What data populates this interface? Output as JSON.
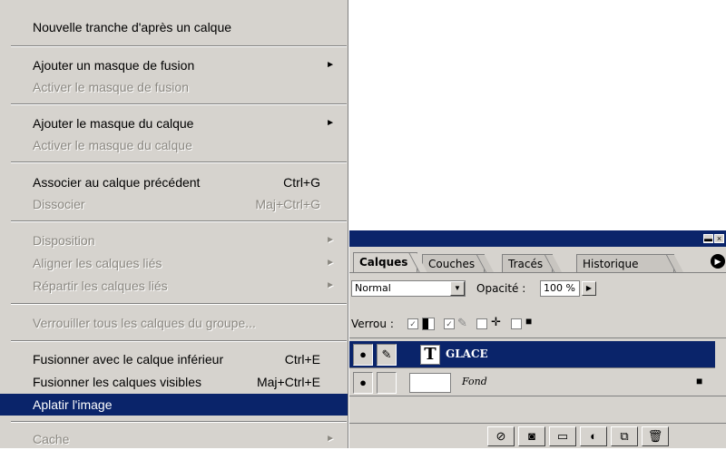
{
  "menu": {
    "items": [
      {
        "label": "Nouvelle tranche d'après un calque",
        "shortcut": "",
        "submenu": false,
        "disabled": false
      },
      {
        "label": "Ajouter un masque de fusion",
        "shortcut": "",
        "submenu": true,
        "disabled": false
      },
      {
        "label": "Activer le masque de fusion",
        "shortcut": "",
        "submenu": false,
        "disabled": true
      },
      {
        "label": "Ajouter le masque du calque",
        "shortcut": "",
        "submenu": true,
        "disabled": false
      },
      {
        "label": "Activer le masque du calque",
        "shortcut": "",
        "submenu": false,
        "disabled": true
      },
      {
        "label": "Associer au calque précédent",
        "shortcut": "Ctrl+G",
        "submenu": false,
        "disabled": false
      },
      {
        "label": "Dissocier",
        "shortcut": "Maj+Ctrl+G",
        "submenu": false,
        "disabled": true
      },
      {
        "label": "Disposition",
        "shortcut": "",
        "submenu": true,
        "disabled": true
      },
      {
        "label": "Aligner les calques liés",
        "shortcut": "",
        "submenu": true,
        "disabled": true
      },
      {
        "label": "Répartir les calques liés",
        "shortcut": "",
        "submenu": true,
        "disabled": true
      },
      {
        "label": "Verrouiller tous les calques du groupe...",
        "shortcut": "",
        "submenu": false,
        "disabled": true
      },
      {
        "label": "Fusionner avec le calque inférieur",
        "shortcut": "Ctrl+E",
        "submenu": false,
        "disabled": false
      },
      {
        "label": "Fusionner les calques visibles",
        "shortcut": "Maj+Ctrl+E",
        "submenu": false,
        "disabled": false
      },
      {
        "label": "Aplatir l'image",
        "shortcut": "",
        "submenu": false,
        "disabled": false,
        "selected": true
      },
      {
        "label": "Cache",
        "shortcut": "",
        "submenu": true,
        "disabled": true
      }
    ],
    "submenu_arrow": "►"
  },
  "layers_panel": {
    "tabs": [
      "Calques",
      "Couches",
      "Tracés",
      "Historique"
    ],
    "active_tab": "Calques",
    "blend_mode": "Normal",
    "opacity_label": "Opacité :",
    "opacity_value": "100 %",
    "lock_label": "Verrou :",
    "layers": [
      {
        "name": "GLACE",
        "type": "text",
        "type_glyph": "T",
        "selected": true,
        "visible": true
      },
      {
        "name": "Fond",
        "type": "background",
        "selected": false,
        "visible": true,
        "locked": true
      }
    ],
    "eye_glyph": "👁",
    "brush_glyph": "✎",
    "lock_glyph": "🔒",
    "colors": {
      "selection": "#0a246a",
      "panel": "#d6d3ce",
      "title_bar": "#0a246a"
    }
  }
}
